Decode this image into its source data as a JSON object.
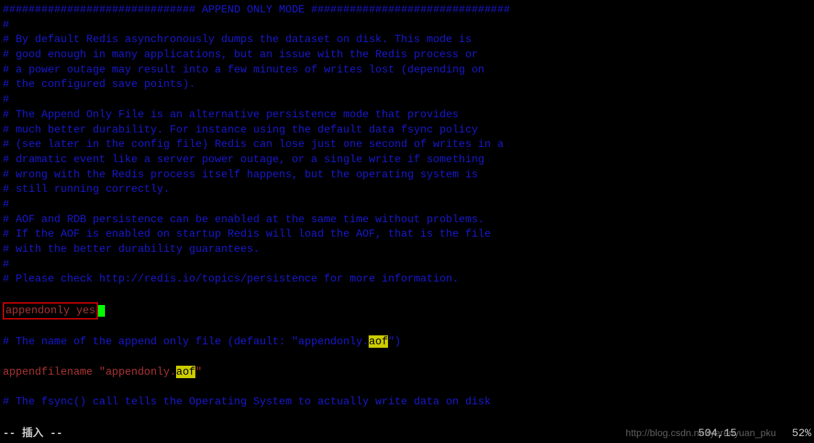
{
  "lines": {
    "header": "############################## APPEND ONLY MODE ###############################",
    "c1": "#",
    "c2": "# By default Redis asynchronously dumps the dataset on disk. This mode is",
    "c3": "# good enough in many applications, but an issue with the Redis process or",
    "c4": "# a power outage may result into a few minutes of writes lost (depending on",
    "c5": "# the configured save points).",
    "c6": "#",
    "c7": "# The Append Only File is an alternative persistence mode that provides",
    "c8": "# much better durability. For instance using the default data fsync policy",
    "c9": "# (see later in the config file) Redis can lose just one second of writes in a",
    "c10": "# dramatic event like a server power outage, or a single write if something",
    "c11": "# wrong with the Redis process itself happens, but the operating system is",
    "c12": "# still running correctly.",
    "c13": "#",
    "c14": "# AOF and RDB persistence can be enabled at the same time without problems.",
    "c15": "# If the AOF is enabled on startup Redis will load the AOF, that is the file",
    "c16": "# with the better durability guarantees.",
    "c17": "#",
    "c18": "# Please check http://redis.io/topics/persistence for more information.",
    "appendonly": "appendonly yes",
    "c19_prefix": "# The name of the append only file (default: \"appendonly.",
    "c19_hl": "aof",
    "c19_suffix": "\")",
    "afn_key": "appendfilename ",
    "afn_quote": "\"",
    "afn_val_prefix": "appendonly.",
    "afn_val_hl": "aof",
    "c20": "# The fsync() call tells the Operating System to actually write data on disk"
  },
  "status": {
    "mode": "-- 插入 --",
    "position": "504,15",
    "percent": "52%"
  },
  "watermark": "http://blog.csdn.net/yerenyuan_pku"
}
